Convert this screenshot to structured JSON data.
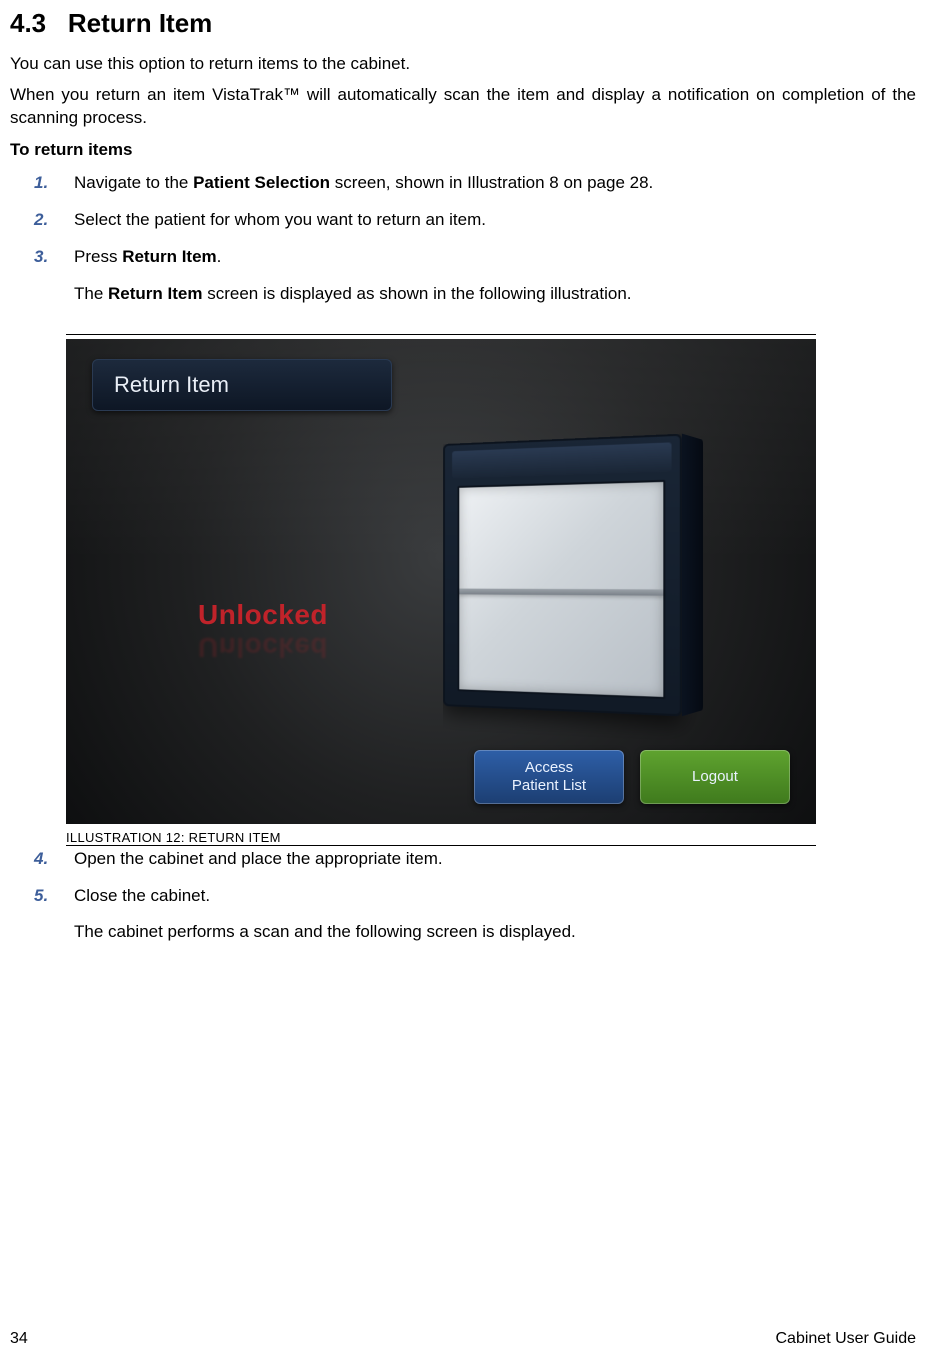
{
  "heading": {
    "number": "4.3",
    "title": "Return Item"
  },
  "intro1": "You can use this option to return items to the cabinet.",
  "intro2": "When you return an item VistaTrak™ will automatically scan the item and display a notification on completion of  the scanning process.",
  "subheading": "To return items",
  "steps": {
    "s1": {
      "num": "1.",
      "pre": "Navigate to the ",
      "bold": "Patient Selection",
      "post": " screen, shown  in Illustration 8 on page 28."
    },
    "s2": {
      "num": "2.",
      "text": "Select the patient for whom you want to return an item."
    },
    "s3": {
      "num": "3.",
      "pre": "Press ",
      "bold": "Return Item",
      "post": ".",
      "detail_pre": "The ",
      "detail_bold": "Return Item",
      "detail_post": " screen is displayed as shown in the following illustration."
    },
    "s4": {
      "num": "4.",
      "text": "Open the cabinet and place the appropriate item."
    },
    "s5": {
      "num": "5.",
      "text": "Close the cabinet.",
      "detail": "The cabinet performs a scan and the following screen is displayed."
    }
  },
  "illustration": {
    "title_bar": "Return Item",
    "status": "Unlocked",
    "btn_access_l1": "Access",
    "btn_access_l2": "Patient List",
    "btn_logout": "Logout",
    "caption_prefix": "I",
    "caption_word1_rest": "LLUSTRATION",
    "caption_number": " 12: ",
    "caption_word2_first": "R",
    "caption_word2_rest": "ETURN ITEM"
  },
  "footer": {
    "page": "34",
    "doc": "Cabinet User Guide"
  }
}
